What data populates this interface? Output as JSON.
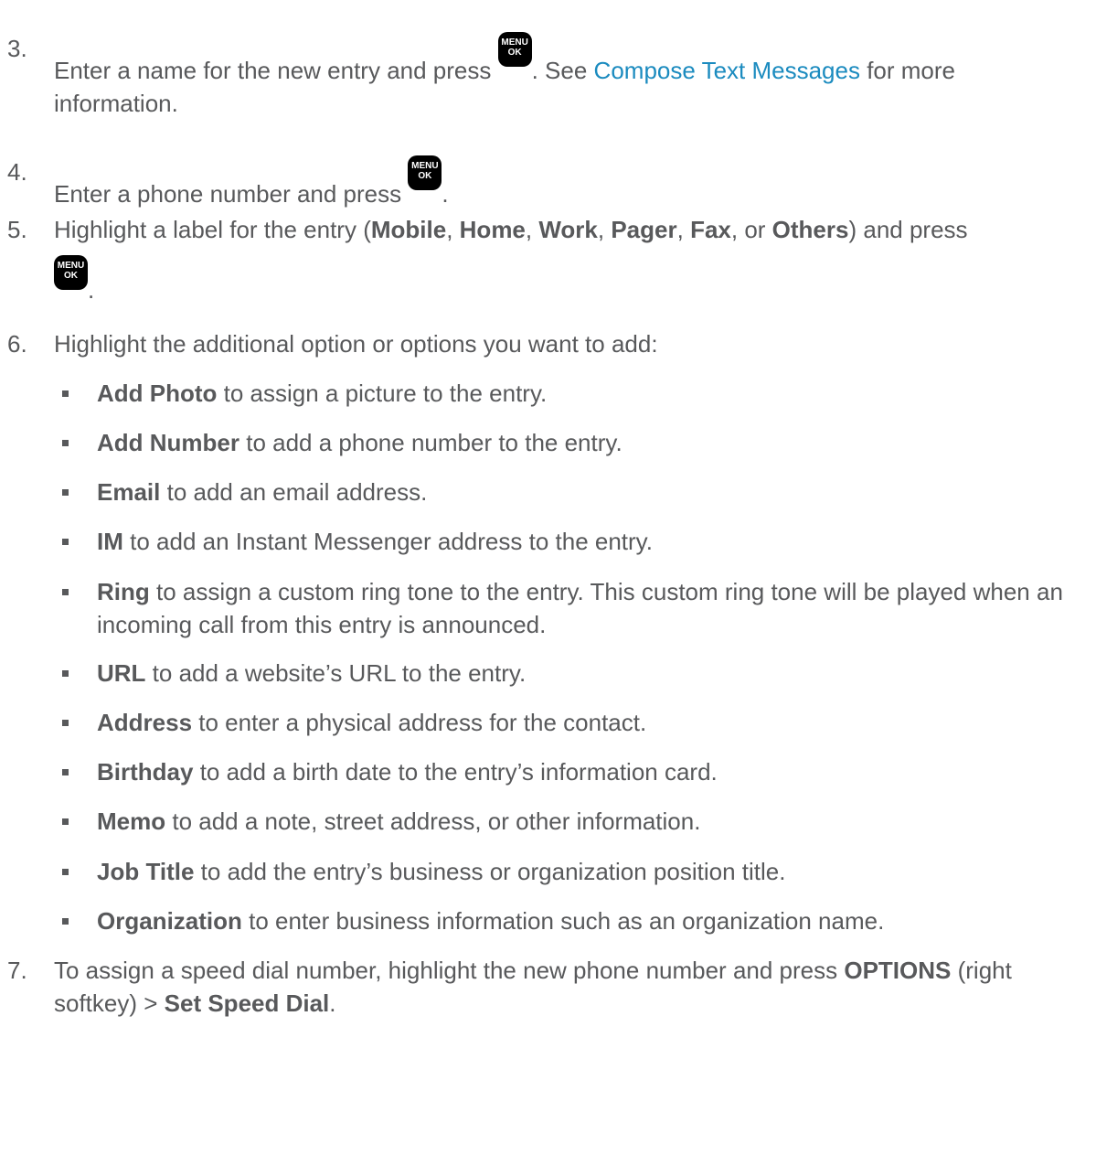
{
  "key": {
    "line1": "MENU",
    "line2": "OK"
  },
  "steps": [
    {
      "number": "3.",
      "text_a": "Enter a name for the new entry and press ",
      "text_b": ". See ",
      "link": "Compose Text Messages",
      "text_c": " for more information."
    },
    {
      "number": "4.",
      "text_a": "Enter a phone number and press ",
      "text_b": "."
    },
    {
      "number": "5.",
      "text_a": "Highlight a label for the entry (",
      "opt1": "Mobile",
      "sep1": ", ",
      "opt2": "Home",
      "sep2": ", ",
      "opt3": "Work",
      "sep3": ", ",
      "opt4": "Pager",
      "sep4": ", ",
      "opt5": "Fax",
      "sep5": ", or ",
      "opt6": "Others",
      "text_b": ") and press",
      "text_c": "."
    },
    {
      "number": "6.",
      "text_a": "Highlight the additional option or options you want to add:"
    },
    {
      "number": "7.",
      "text_a": "To assign a speed dial number, highlight the new phone number and press ",
      "bold1": "OPTIONS",
      "text_b": " (right softkey) > ",
      "bold2": "Set Speed Dial",
      "text_c": "."
    }
  ],
  "options": [
    {
      "term": "Add Photo",
      "desc": " to assign a picture to the entry."
    },
    {
      "term": "Add Number",
      "desc": " to add a phone number to the entry."
    },
    {
      "term": "Email",
      "desc": " to add an email address."
    },
    {
      "term": "IM",
      "desc": " to add an Instant Messenger address to the entry."
    },
    {
      "term": "Ring",
      "desc": " to assign a custom ring tone to the entry. This custom ring tone will be played when an incoming call from this entry is announced."
    },
    {
      "term": "URL",
      "desc": " to add a website’s URL to the entry."
    },
    {
      "term": "Address",
      "desc": " to enter a physical address for the contact."
    },
    {
      "term": "Birthday",
      "desc": " to add a birth date to the entry’s information card."
    },
    {
      "term": "Memo",
      "desc": " to add a note, street address, or other information."
    },
    {
      "term": "Job Title",
      "desc": " to add the entry’s business or organization position title."
    },
    {
      "term": "Organization",
      "desc": " to enter business information such as an organization name."
    }
  ]
}
